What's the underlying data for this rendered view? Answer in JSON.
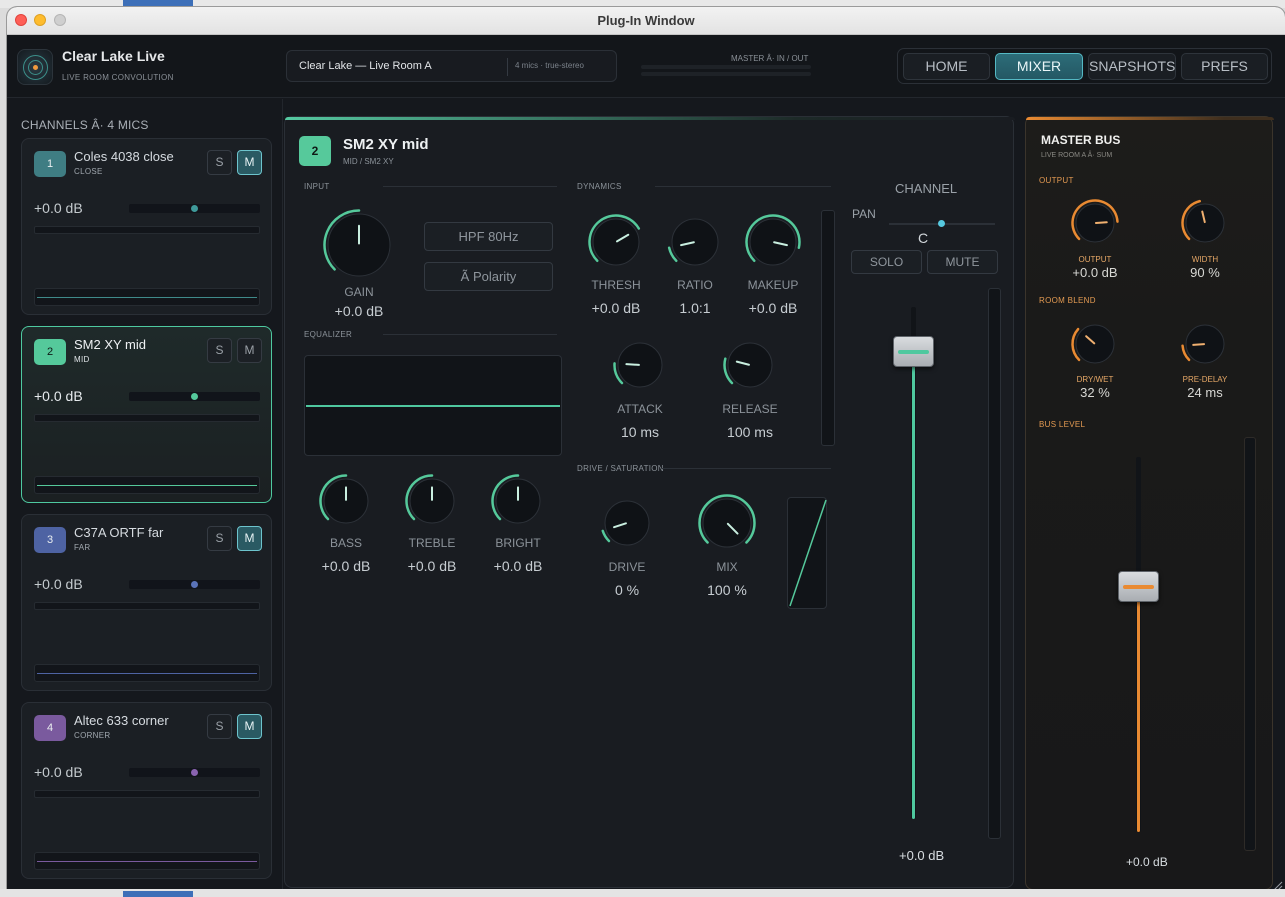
{
  "window": {
    "title": "Plug-In Window"
  },
  "app": {
    "name": "Clear Lake Live",
    "subtitle": "LIVE ROOM CONVOLUTION"
  },
  "preset": {
    "name": "Clear Lake — Live Room A",
    "meta": "4 mics · true-stereo"
  },
  "master_meter": {
    "label": "MASTER Â· IN / OUT"
  },
  "tabs": [
    {
      "label": "HOME",
      "active": false
    },
    {
      "label": "MIXER",
      "active": true
    },
    {
      "label": "SNAPSHOTS",
      "active": false
    },
    {
      "label": "PREFS",
      "active": false
    }
  ],
  "channels_header": "CHANNELS  Â·  4 MICS",
  "channels": [
    {
      "num": "1",
      "name": "Coles 4038 close",
      "sub": "CLOSE",
      "solo": "S",
      "mute": "M",
      "muted": true,
      "gain": "+0.0 dB",
      "color": "#3f7d83",
      "pan": 0.5
    },
    {
      "num": "2",
      "name": "SM2 XY mid",
      "sub": "MID",
      "solo": "S",
      "mute": "M",
      "muted": false,
      "gain": "+0.0 dB",
      "color": "#55c99b",
      "pan": 0.5
    },
    {
      "num": "3",
      "name": "C37A ORTF far",
      "sub": "FAR",
      "solo": "S",
      "mute": "M",
      "muted": true,
      "gain": "+0.0 dB",
      "color": "#4e63a3",
      "pan": 0.5
    },
    {
      "num": "4",
      "name": "Altec 633 corner",
      "sub": "CORNER",
      "solo": "S",
      "mute": "M",
      "muted": true,
      "gain": "+0.0 dB",
      "color": "#7a5a9e",
      "pan": 0.5
    }
  ],
  "strip": {
    "num": "2",
    "name": "SM2 XY mid",
    "sub": "MID / SM2 XY",
    "sections": {
      "input": "INPUT",
      "equalizer": "EQUALIZER",
      "dynamics": "DYNAMICS",
      "drive": "DRIVE / SATURATION"
    },
    "gain": {
      "label": "GAIN",
      "value": "+0.0 dB",
      "level": 0.5
    },
    "hpf": "HPF 80Hz",
    "polarity": "Ã  Polarity",
    "eq": [
      {
        "label": "BASS",
        "value": "+0.0 dB",
        "level": 0.5
      },
      {
        "label": "TREBLE",
        "value": "+0.0 dB",
        "level": 0.5
      },
      {
        "label": "BRIGHT",
        "value": "+0.0 dB",
        "level": 0.5
      }
    ],
    "dynamics": [
      {
        "label": "THRESH",
        "value": "+0.0 dB",
        "level": 0.72
      },
      {
        "label": "RATIO",
        "value": "1.0:1",
        "level": 0.12
      },
      {
        "label": "MAKEUP",
        "value": "+0.0 dB",
        "level": 0.88
      },
      {
        "label": "ATTACK",
        "value": "10 ms",
        "level": 0.18
      },
      {
        "label": "RELEASE",
        "value": "100 ms",
        "level": 0.22
      }
    ],
    "drive": [
      {
        "label": "DRIVE",
        "value": "0 %",
        "level": 0.1
      },
      {
        "label": "MIX",
        "value": "100 %",
        "level": 1.0
      }
    ],
    "channel": {
      "title": "CHANNEL",
      "pan_label": "PAN",
      "pan_value": "C",
      "pan": 0.5,
      "solo": "SOLO",
      "mute": "MUTE",
      "fader_value": "+0.0 dB",
      "fader_level": 0.94
    }
  },
  "master": {
    "title": "MASTER BUS",
    "sub": "LIVE ROOM A Â· SUM",
    "output_section": "OUTPUT",
    "blend_section": "ROOM BLEND",
    "bus_section": "BUS LEVEL",
    "knobs": [
      {
        "label": "OUTPUT",
        "value": "+0.0 dB",
        "level": 0.82
      },
      {
        "label": "WIDTH",
        "value": "90 %",
        "level": 0.45
      },
      {
        "label": "DRY/WET",
        "value": "32 %",
        "level": 0.32
      },
      {
        "label": "PRE-DELAY",
        "value": "24 ms",
        "level": 0.15
      }
    ],
    "fader_value": "+0.0 dB",
    "fader_level": 0.67
  },
  "colors": {
    "accent": "#55c99b",
    "master_accent": "#e98a32",
    "teal": "#55b9c4"
  }
}
